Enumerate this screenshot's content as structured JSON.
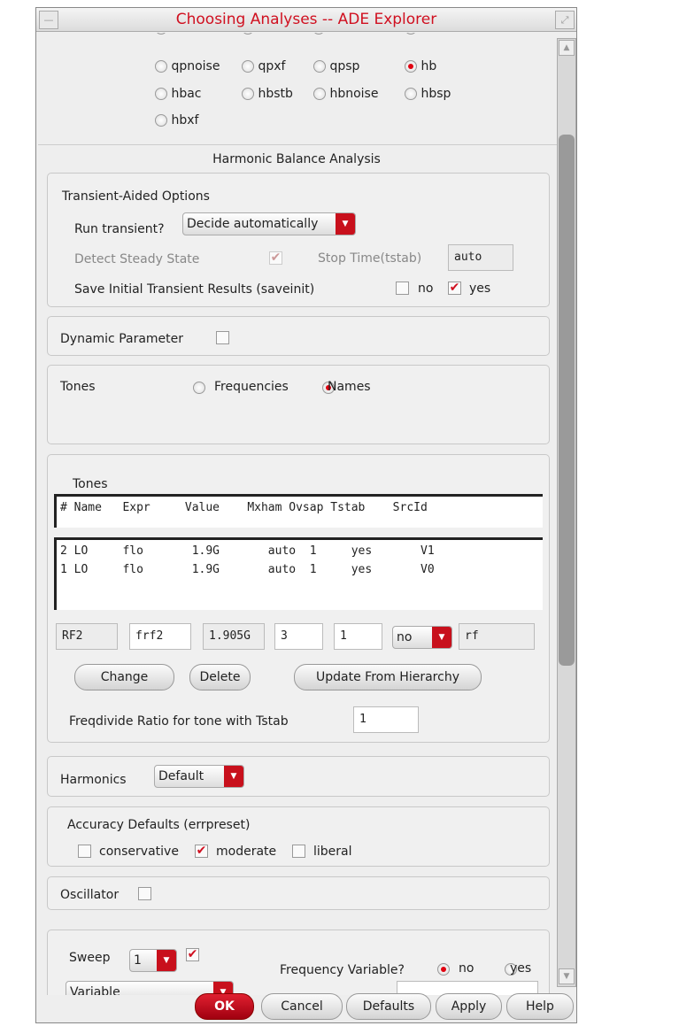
{
  "window": {
    "title": "Choosing Analyses -- ADE Explorer"
  },
  "analyses": [
    {
      "label": "qpnoise",
      "selected": false
    },
    {
      "label": "qpxf",
      "selected": false
    },
    {
      "label": "qpsp",
      "selected": false
    },
    {
      "label": "hb",
      "selected": true
    },
    {
      "label": "hbac",
      "selected": false
    },
    {
      "label": "hbstb",
      "selected": false
    },
    {
      "label": "hbnoise",
      "selected": false
    },
    {
      "label": "hbsp",
      "selected": false
    },
    {
      "label": "hbxf",
      "selected": false
    }
  ],
  "section_title": "Harmonic Balance Analysis",
  "transient": {
    "title": "Transient-Aided Options",
    "run_label": "Run transient?",
    "run_value": "Decide automatically",
    "detect_label": "Detect Steady State",
    "detect_check": "✔",
    "stop_label": "Stop Time(tstab)",
    "stop_value": "auto",
    "save_label": "Save Initial Transient Results (saveinit)",
    "no": "no",
    "yes": "yes",
    "check": "✔"
  },
  "dynamic": {
    "label": "Dynamic Parameter"
  },
  "tones_mode": {
    "label": "Tones",
    "frequencies": "Frequencies",
    "names": "Names",
    "selected": "Names"
  },
  "tones": {
    "title": "Tones",
    "headers": "# Name   Expr     Value    Mxham Ovsap Tstab    SrcId",
    "rows": [
      "2 LO     flo       1.9G       auto  1     yes       V1",
      "1 LO     flo       1.9G       auto  1     yes       V0"
    ],
    "edit": {
      "name": "RF2",
      "expr": "frf2",
      "value": "1.905G",
      "mxham": "3",
      "ovsap": "1",
      "tstab": "no",
      "srcid": "rf"
    },
    "change": "Change",
    "delete": "Delete",
    "update": "Update From Hierarchy",
    "freqdiv_label": "Freqdivide Ratio for tone with Tstab",
    "freqdiv_value": "1"
  },
  "harmonics": {
    "label": "Harmonics",
    "value": "Default"
  },
  "accuracy": {
    "title": "Accuracy Defaults (errpreset)",
    "conservative": "conservative",
    "moderate": "moderate",
    "liberal": "liberal",
    "check": "✔"
  },
  "oscillator": {
    "label": "Oscillator"
  },
  "sweep": {
    "label": "Sweep",
    "value": "1",
    "check": "✔",
    "variable": "Variable",
    "freq_label": "Frequency Variable?",
    "no": "no",
    "yes": "yes"
  },
  "buttons": {
    "ok": "OK",
    "cancel": "Cancel",
    "defaults": "Defaults",
    "apply": "Apply",
    "help": "Help"
  }
}
